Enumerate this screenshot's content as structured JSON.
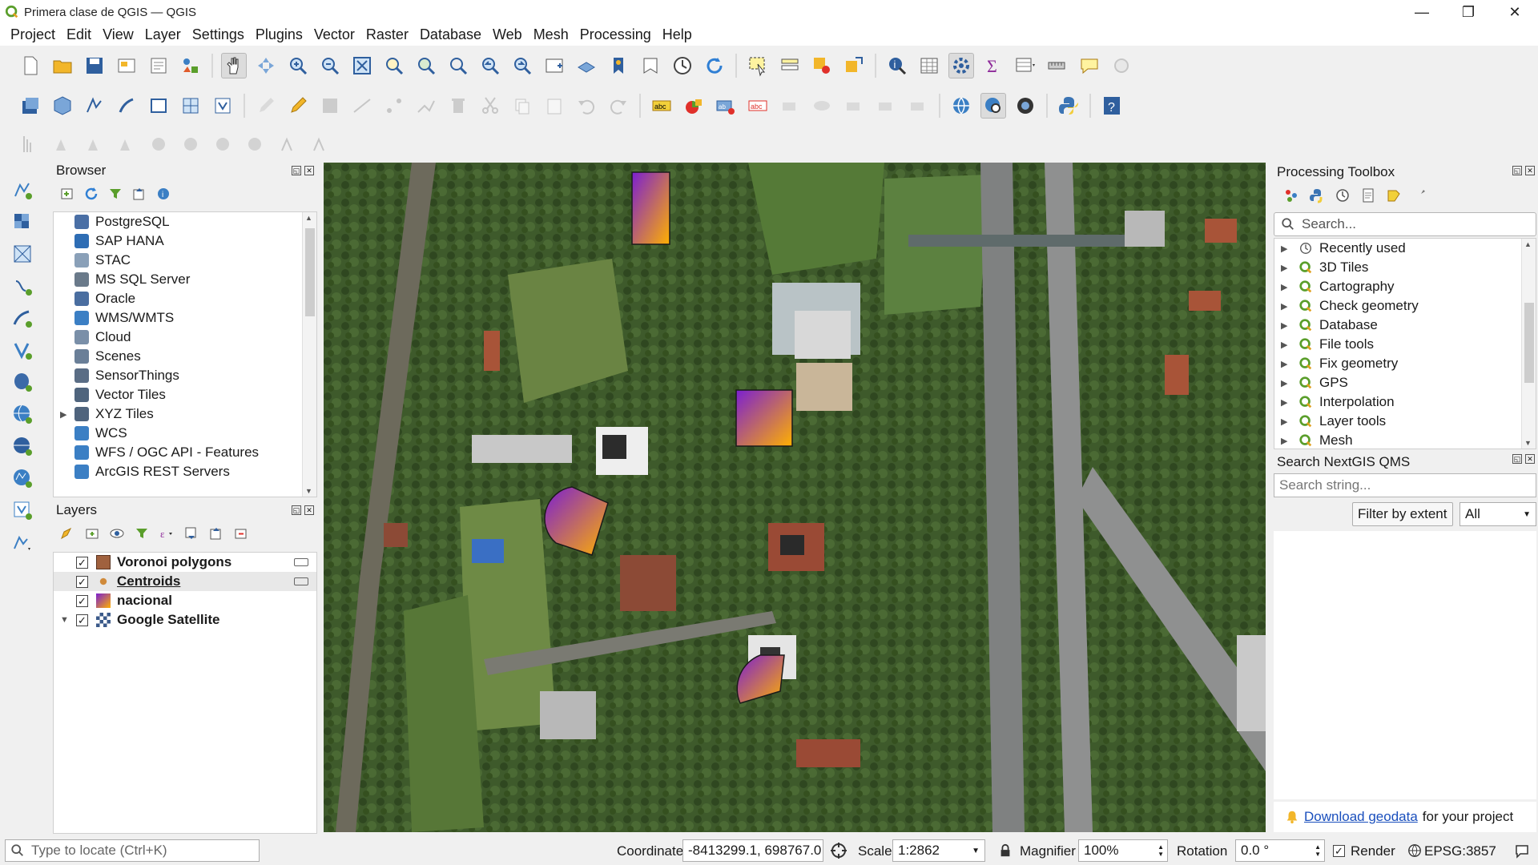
{
  "window": {
    "title": "Primera clase de QGIS — QGIS",
    "minimize": "—",
    "maximize": "❐",
    "close": "✕"
  },
  "menus": [
    "Project",
    "Edit",
    "View",
    "Layer",
    "Settings",
    "Plugins",
    "Vector",
    "Raster",
    "Database",
    "Web",
    "Mesh",
    "Processing",
    "Help"
  ],
  "browser": {
    "title": "Browser",
    "items": [
      {
        "label": "PostgreSQL",
        "icon": "postgresql-icon",
        "color": "#4a6fa5"
      },
      {
        "label": "SAP HANA",
        "icon": "sap-hana-icon",
        "color": "#2e6db4"
      },
      {
        "label": "STAC",
        "icon": "stac-icon",
        "color": "#8aa0b8"
      },
      {
        "label": "MS SQL Server",
        "icon": "mssql-icon",
        "color": "#6a7a8a"
      },
      {
        "label": "Oracle",
        "icon": "oracle-icon",
        "color": "#4a6ea0"
      },
      {
        "label": "WMS/WMTS",
        "icon": "wms-icon",
        "color": "#3b7fc4"
      },
      {
        "label": "Cloud",
        "icon": "cloud-icon",
        "color": "#7a8fa8"
      },
      {
        "label": "Scenes",
        "icon": "scenes-icon",
        "color": "#6a7f98"
      },
      {
        "label": "SensorThings",
        "icon": "sensorthings-icon",
        "color": "#5a6d85"
      },
      {
        "label": "Vector Tiles",
        "icon": "vector-tiles-icon",
        "color": "#4f647d"
      },
      {
        "label": "XYZ Tiles",
        "icon": "xyz-tiles-icon",
        "color": "#4f647d",
        "expandable": true
      },
      {
        "label": "WCS",
        "icon": "wcs-icon",
        "color": "#3b7fc4"
      },
      {
        "label": "WFS / OGC API - Features",
        "icon": "wfs-icon",
        "color": "#3b7fc4"
      },
      {
        "label": "ArcGIS REST Servers",
        "icon": "arcgis-icon",
        "color": "#3b7fc4"
      }
    ]
  },
  "layers": {
    "title": "Layers",
    "items": [
      {
        "label": "Voronoi polygons",
        "checked": "✓",
        "symbol": "fill-swatch",
        "color": "#a0613e",
        "tag": true,
        "selected": false
      },
      {
        "label": "Centroids",
        "checked": "✓",
        "symbol": "point-marker",
        "color": "#d08a3a",
        "tag": true,
        "selected": true
      },
      {
        "label": "nacional",
        "checked": "✓",
        "symbol": "raster-gradient",
        "color": "#8b2fb0",
        "tag": false,
        "selected": false
      },
      {
        "label": "Google Satellite",
        "checked": "✓",
        "symbol": "xyz-tile",
        "color": "#3b5a8a",
        "tag": false,
        "selected": false,
        "expandable": true
      }
    ]
  },
  "toolbox": {
    "title": "Processing Toolbox",
    "search_placeholder": "Search...",
    "items": [
      {
        "label": "Recently used",
        "icon": "clock-icon"
      },
      {
        "label": "3D Tiles",
        "icon": "qgis-icon"
      },
      {
        "label": "Cartography",
        "icon": "qgis-icon"
      },
      {
        "label": "Check geometry",
        "icon": "qgis-icon"
      },
      {
        "label": "Database",
        "icon": "qgis-icon"
      },
      {
        "label": "File tools",
        "icon": "qgis-icon"
      },
      {
        "label": "Fix geometry",
        "icon": "qgis-icon"
      },
      {
        "label": "GPS",
        "icon": "qgis-icon"
      },
      {
        "label": "Interpolation",
        "icon": "qgis-icon"
      },
      {
        "label": "Layer tools",
        "icon": "qgis-icon"
      },
      {
        "label": "Mesh",
        "icon": "qgis-icon"
      }
    ]
  },
  "qms": {
    "title": "Search NextGIS QMS",
    "search_placeholder": "Search string...",
    "filter_button": "Filter by extent",
    "filter_value": "All",
    "notice_link": "Download geodata",
    "notice_suffix": "for your project"
  },
  "statusbar": {
    "locate_placeholder": "Type to locate (Ctrl+K)",
    "coordinate_label": "Coordinate",
    "coordinate_value": "-8413299.1, 698767.0",
    "scale_label": "Scale",
    "scale_value": "1:2862",
    "magnifier_label": "Magnifier",
    "magnifier_value": "100%",
    "rotation_label": "Rotation",
    "rotation_value": "0.0 °",
    "render_label": "Render",
    "render_checked": "✓",
    "crs": "EPSG:3857"
  },
  "colors": {
    "gradient_start": "#7b1fd1",
    "gradient_end": "#ffb000",
    "map_vegetation": "#3f5a2a",
    "road": "#8f9090"
  }
}
